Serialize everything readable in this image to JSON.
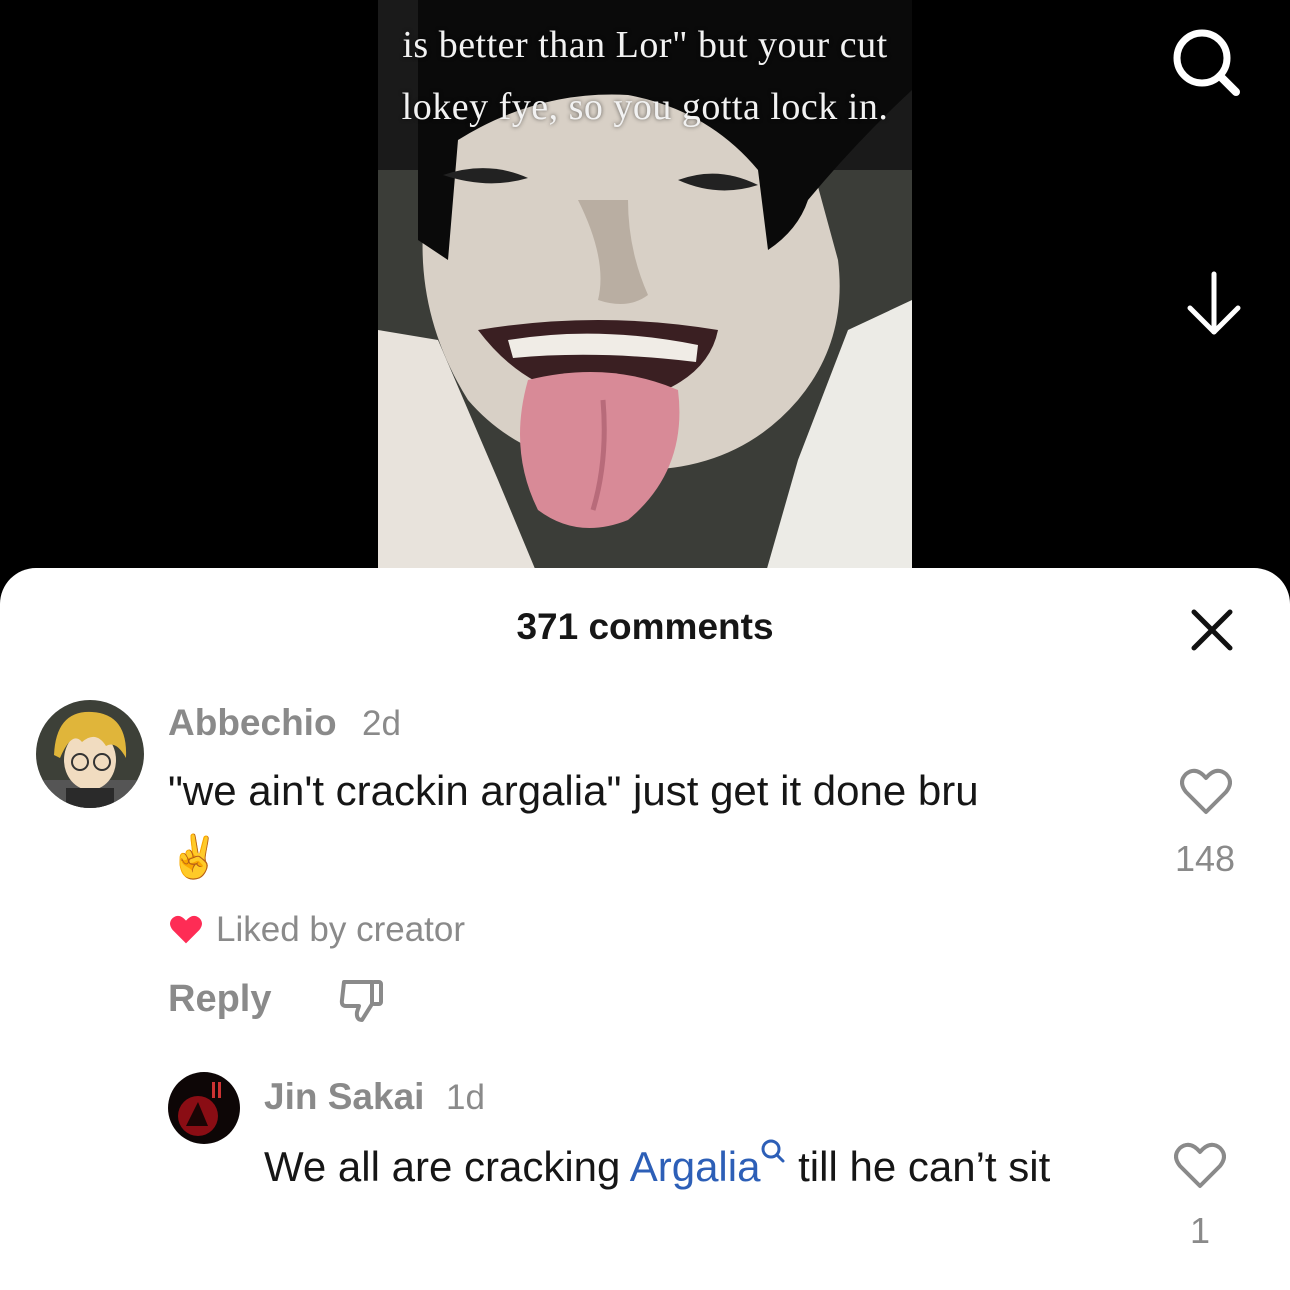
{
  "video": {
    "caption_lines": [
      "is better than Lor\" but your cut",
      "lokey fye, so you gotta lock in."
    ],
    "search_icon": "search-icon",
    "download_icon": "arrow-down-icon"
  },
  "comments_panel": {
    "title": "371 comments",
    "close_icon": "close-icon",
    "comments": [
      {
        "username": "Abbechio",
        "time": "2d",
        "text": "\"we ain't crackin argalia\" just get it done bru",
        "emoji": "✌️",
        "likes": "148",
        "liked_by_creator": "Liked by creator",
        "reply_label": "Reply"
      },
      {
        "username": "Jin Sakai",
        "time": "1d",
        "text_before": "We all are cracking ",
        "mention": "Argalia",
        "text_after": " till he can’t sit",
        "likes": "1"
      }
    ]
  },
  "colors": {
    "accent_heart": "#fe2c55",
    "mention_link": "#2d5fb7",
    "muted_text": "#8a8a8a"
  }
}
